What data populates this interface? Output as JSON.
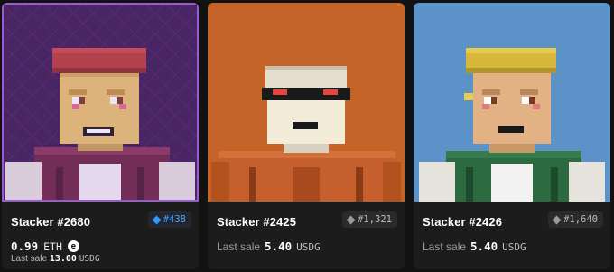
{
  "cards": [
    {
      "name": "Stacker #2680",
      "rank": "#438",
      "price_value": "0.99",
      "price_unit": "ETH",
      "last_sale_label": "Last sale",
      "last_sale_value": "13.00",
      "last_sale_unit": "USDG",
      "background_color": "#3a1c4e",
      "selected": true,
      "hat_color": "#b83e35",
      "skin_color": "#e8c56a",
      "shirt_color": "#6b2740"
    },
    {
      "name": "Stacker #2425",
      "rank": "#1,321",
      "last_sale_label": "Last sale",
      "last_sale_value": "5.40",
      "last_sale_unit": "USDG",
      "background_color": "#c46428",
      "hair_color": "#e6dfcf",
      "skin_color": "#f3ecd9",
      "shirt_color": "#c55f2d"
    },
    {
      "name": "Stacker #2426",
      "rank": "#1,640",
      "last_sale_label": "Last sale",
      "last_sale_value": "5.40",
      "last_sale_unit": "USDG",
      "background_color": "#5b93c9",
      "hat_color": "#d8b83a",
      "skin_color": "#e2b285",
      "shirt_color": "#2c6a3f"
    }
  ],
  "colors": {
    "rank_highlight": "#2e9bff",
    "selected_outline": "#9b59d6",
    "card_background": "#1c1c1c"
  },
  "icons": [
    "diamond-icon",
    "eth-icon"
  ]
}
